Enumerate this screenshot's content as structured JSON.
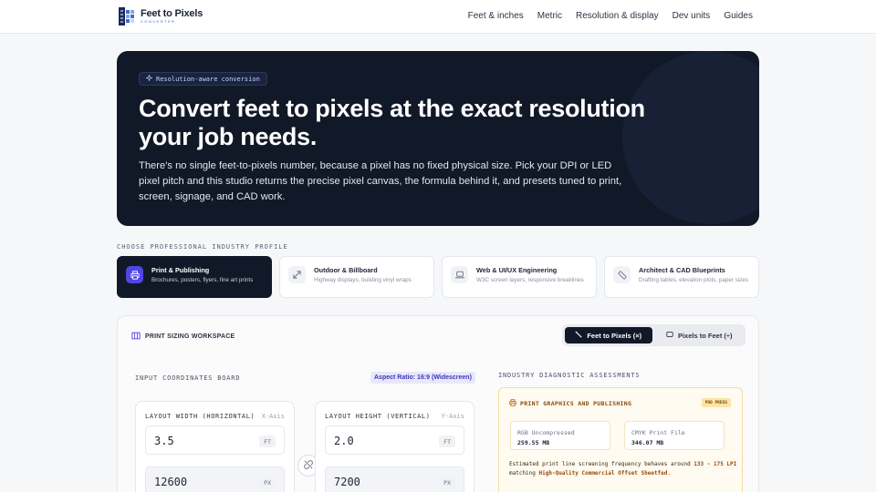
{
  "brand": {
    "title": "Feet to Pixels",
    "subtitle": "CONVERTER"
  },
  "nav": [
    "Feet & inches",
    "Metric",
    "Resolution & display",
    "Dev units",
    "Guides"
  ],
  "hero": {
    "pill": "Resolution-aware conversion",
    "title": "Convert feet to pixels at the exact resolution your job needs.",
    "description": "There's no single feet-to-pixels number, because a pixel has no fixed physical size. Pick your DPI or LED pixel pitch and this studio returns the precise pixel canvas, the formula behind it, and presets tuned to print, screen, signage, and CAD work."
  },
  "profiles": {
    "label": "CHOOSE PROFESSIONAL INDUSTRY PROFILE",
    "items": [
      {
        "title": "Print & Publishing",
        "sub": "Brochures, posters, flyers, fine art prints",
        "icon": "printer-icon",
        "active": true
      },
      {
        "title": "Outdoor & Billboard",
        "sub": "Highway displays, building vinyl wraps",
        "icon": "expand-icon",
        "active": false
      },
      {
        "title": "Web & UI/UX Engineering",
        "sub": "W3C screen layers, responsive breaklines",
        "icon": "laptop-icon",
        "active": false
      },
      {
        "title": "Architect & CAD Blueprints",
        "sub": "Drafting tables, elevation plots, paper sizes",
        "icon": "ruler-icon",
        "active": false
      }
    ]
  },
  "workspace": {
    "title": "PRINT SIZING WORKSPACE",
    "mode_feet_to_px": "Feet to Pixels (×)",
    "mode_px_to_feet": "Pixels to Feet (÷)",
    "board_label": "INPUT COORDINATES BOARD",
    "aspect_ratio": "Aspect Ratio: 16:9 (Widescreen)",
    "width_card": {
      "title": "LAYOUT WIDTH (HORIZONTAL)",
      "axis": "X-Axis",
      "feet": "3.5",
      "feet_unit": "FT",
      "pixels": "12600",
      "pixel_unit": "PX"
    },
    "height_card": {
      "title": "LAYOUT HEIGHT (VERTICAL)",
      "axis": "Y-Axis",
      "feet": "2.0",
      "feet_unit": "FT",
      "pixels": "7200",
      "pixel_unit": "PX"
    }
  },
  "diagnostics": {
    "label": "INDUSTRY DIAGNOSTIC ASSESSMENTS",
    "title": "PRINT GRAPHICS AND PUBLISHING",
    "badge": "PRO PRESS",
    "rgb_label": "RGB Uncompressed",
    "rgb_value": "259.55 MB",
    "cmyk_label": "CMYK Print File",
    "cmyk_value": "346.07 MB",
    "note_prefix": "Estimated print line screening frequency behaves around ",
    "note_range": "133 - 175 LPI",
    "note_mid": " matching ",
    "note_match": "High-Quality Commercial Offset Sheetfed",
    "note_end": "."
  },
  "colors": {
    "accent": "#4f46e5",
    "dark": "#111827",
    "amber": "#f3dca3"
  }
}
